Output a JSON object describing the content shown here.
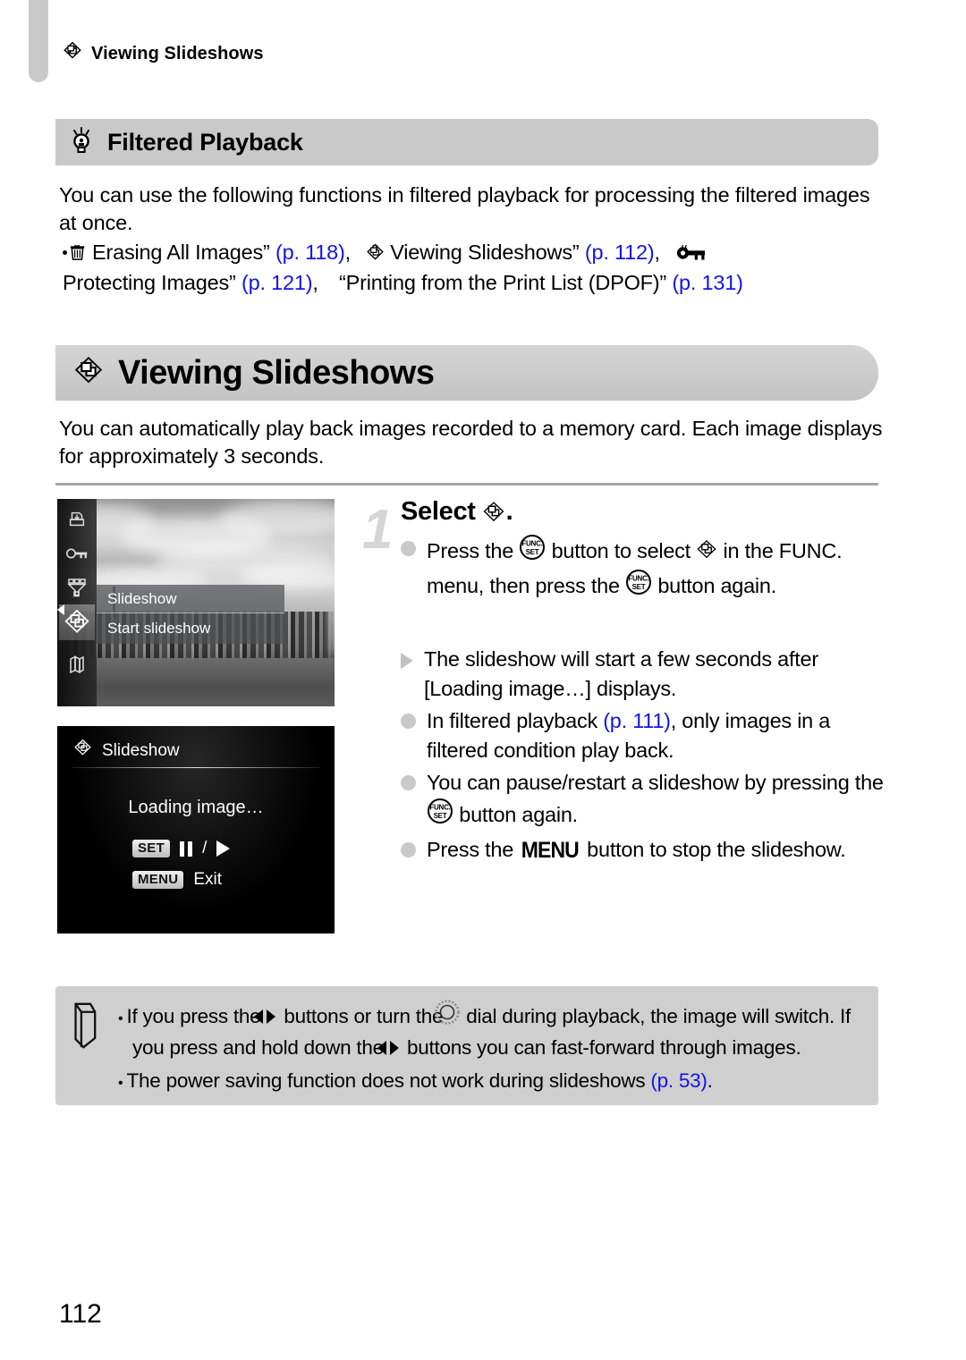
{
  "running_head": {
    "icon": "slideshow-icon",
    "text": "Viewing Slideshows"
  },
  "tip": {
    "icon": "lightbulb-icon",
    "title": "Filtered Playback",
    "paragraph": "You can use the following functions in filtered playback for processing the filtered images at once.",
    "bullet": {
      "seg1": "“",
      "icon1": "trash-icon",
      "seg2": " Erasing All Images” ",
      "link1": "(p. 118)",
      "seg3": ", “",
      "icon2": "slideshow-icon",
      "seg4": " Viewing Slideshows” ",
      "link2": "(p. 112)",
      "seg5": ", “",
      "icon3": "key-icon",
      "seg6": " Protecting Images” ",
      "link3": "(p. 121)",
      "seg7": ", “Printing from the Print List (DPOF)” ",
      "link4": "(p. 131)"
    }
  },
  "section": {
    "icon": "slideshow-icon",
    "title": "Viewing Slideshows",
    "intro": "You can automatically play back images recorded to a memory card. Each image displays for approximately 3 seconds."
  },
  "screenshot_one": {
    "sidebar_icons": [
      "print-icon",
      "protect-key-icon",
      "filter-funnel-icon",
      "slideshow-icon",
      "group-images-icon"
    ],
    "selected_index": 3,
    "menu_title": "Slideshow",
    "menu_item": "Start slideshow"
  },
  "screenshot_two": {
    "header_icon": "slideshow-icon",
    "header": "Slideshow",
    "loading": "Loading image…",
    "set_key": "SET",
    "set_separator": "/",
    "menu_key": "MENU",
    "menu_action": "Exit"
  },
  "step": {
    "number": "1",
    "heading_prefix": "Select ",
    "heading_icon": "slideshow-icon",
    "heading_suffix": ".",
    "items": [
      {
        "bullet": "dot",
        "parts": [
          {
            "t": "text",
            "v": "Press the "
          },
          {
            "t": "icon",
            "v": "func-set-button-icon"
          },
          {
            "t": "text",
            "v": " button to select "
          },
          {
            "t": "icon",
            "v": "slideshow-icon"
          },
          {
            "t": "text",
            "v": " in the FUNC. menu, then press the "
          },
          {
            "t": "icon",
            "v": "func-set-button-icon"
          },
          {
            "t": "text",
            "v": " button again."
          }
        ]
      },
      {
        "bullet": "triangle",
        "parts": [
          {
            "t": "text",
            "v": "The slideshow will start a few seconds after [Loading image…] displays."
          }
        ]
      },
      {
        "bullet": "dot",
        "parts": [
          {
            "t": "text",
            "v": "In filtered playback "
          },
          {
            "t": "link",
            "v": "(p. 111)"
          },
          {
            "t": "text",
            "v": ", only images in a filtered condition play back."
          }
        ]
      },
      {
        "bullet": "dot",
        "parts": [
          {
            "t": "text",
            "v": "You can pause/restart a slideshow by pressing the "
          },
          {
            "t": "icon",
            "v": "func-set-button-icon"
          },
          {
            "t": "text",
            "v": " button again."
          }
        ]
      },
      {
        "bullet": "dot",
        "parts": [
          {
            "t": "text",
            "v": "Press the "
          },
          {
            "t": "menuword",
            "v": "MENU"
          },
          {
            "t": "text",
            "v": " button to stop the slideshow."
          }
        ]
      }
    ]
  },
  "note": {
    "icon": "pencil-icon",
    "rows": [
      {
        "parts": [
          {
            "t": "bullet",
            "v": "•"
          },
          {
            "t": "text",
            "v": "If you press the "
          },
          {
            "t": "icon",
            "v": "left-right-arrows-icon"
          },
          {
            "t": "text",
            "v": " buttons or turn the "
          },
          {
            "t": "icon",
            "v": "control-dial-icon"
          },
          {
            "t": "text",
            "v": " dial during playback, the image will switch. If you press and hold down the "
          },
          {
            "t": "icon",
            "v": "left-right-arrows-icon"
          },
          {
            "t": "text",
            "v": " buttons you can fast-forward through images."
          }
        ]
      },
      {
        "parts": [
          {
            "t": "bullet",
            "v": "•"
          },
          {
            "t": "text",
            "v": "The power saving function does not work during slideshows "
          },
          {
            "t": "link",
            "v": "(p. 53)"
          },
          {
            "t": "text",
            "v": "."
          }
        ]
      }
    ]
  },
  "page_number": "112",
  "colors": {
    "link": "#1414e6",
    "band": "#c9c9c9",
    "bullet": "#c9c9c9"
  }
}
